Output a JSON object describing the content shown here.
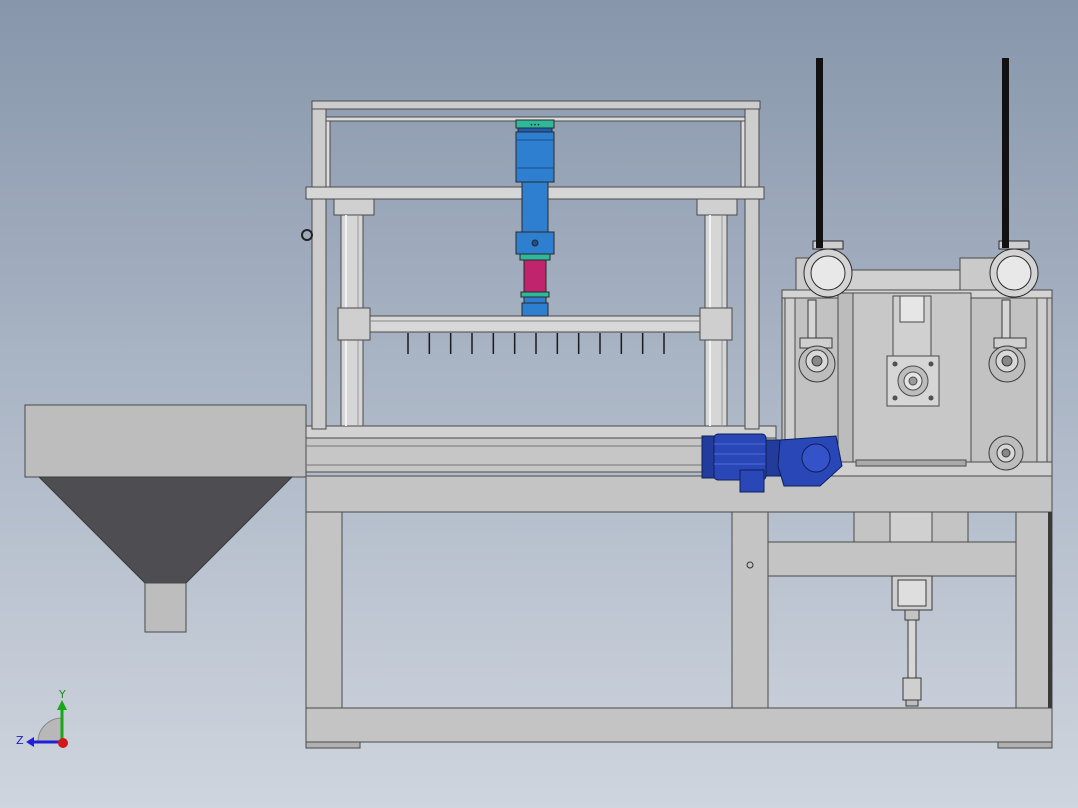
{
  "triad": {
    "y_label": "Y",
    "z_label": "Z",
    "y_color": "#18a818",
    "z_color": "#2020d8",
    "x_color": "#d01818"
  },
  "colors": {
    "background_top": "#8796ab",
    "background_bottom": "#cfd5de",
    "frame_steel": "#c8c8c8",
    "frame_edge": "#4a4a4a",
    "hopper_top": "#bdbdbd",
    "hopper_funnel": "#4e4d52",
    "motor_blue": "#2a47b8",
    "cylinder_blue": "#2e7fd0",
    "cylinder_magenta": "#c0246c",
    "cylinder_cap": "#2fb99a",
    "cable_black": "#111111"
  },
  "components": [
    "hopper",
    "base-frame",
    "upper-gantry-frame",
    "guide-columns",
    "pneumatic-cylinder",
    "needle-bar",
    "gear-motor",
    "drive-gearbox",
    "roller-assembly",
    "cable-chains",
    "lower-push-cylinder"
  ],
  "needle_count": 13
}
